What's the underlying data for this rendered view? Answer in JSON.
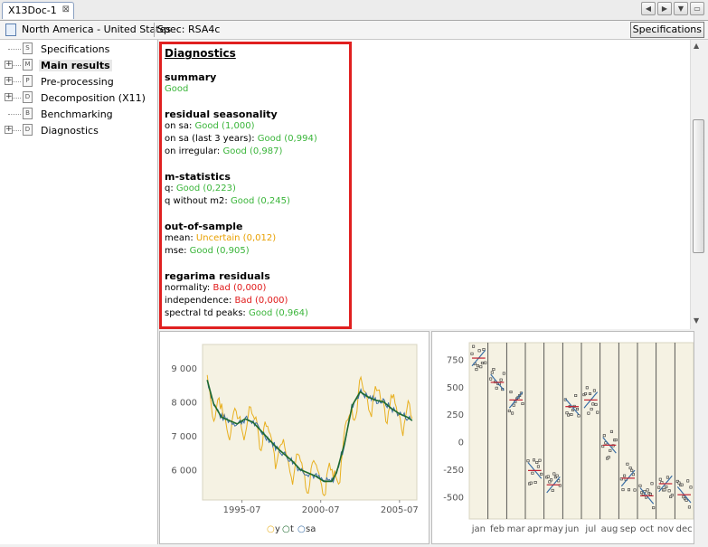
{
  "tab": {
    "title": "X13Doc-1",
    "close": "⊠"
  },
  "nav": {
    "prev": "◀",
    "next": "▶",
    "menu": "▼",
    "restore": "▭"
  },
  "infobar": {
    "region": "North America - United States",
    "spec": "Spec: RSA4c",
    "specifications_button": "Specifications"
  },
  "tree": [
    {
      "label": "Specifications",
      "icon": "S",
      "expandable": false
    },
    {
      "label": "Main results",
      "icon": "M",
      "expandable": true,
      "selected": true
    },
    {
      "label": "Pre-processing",
      "icon": "P",
      "expandable": true
    },
    {
      "label": "Decomposition (X11)",
      "icon": "D",
      "expandable": true
    },
    {
      "label": "Benchmarking",
      "icon": "B",
      "expandable": false
    },
    {
      "label": "Diagnostics",
      "icon": "D",
      "expandable": true
    }
  ],
  "diagnostics": {
    "title": "Diagnostics",
    "summary": {
      "heading": "summary",
      "value": "Good"
    },
    "residual_seasonality": {
      "heading": "residual seasonality",
      "rows": [
        {
          "label": "on sa: ",
          "value": "Good (1,000)",
          "status": "good"
        },
        {
          "label": "on sa (last 3 years): ",
          "value": "Good (0,994)",
          "status": "good"
        },
        {
          "label": "on irregular: ",
          "value": "Good (0,987)",
          "status": "good"
        }
      ]
    },
    "m_statistics": {
      "heading": "m-statistics",
      "rows": [
        {
          "label": "q: ",
          "value": "Good (0,223)",
          "status": "good"
        },
        {
          "label": "q without m2: ",
          "value": "Good (0,245)",
          "status": "good"
        }
      ]
    },
    "out_of_sample": {
      "heading": "out-of-sample",
      "rows": [
        {
          "label": "mean: ",
          "value": "Uncertain (0,012)",
          "status": "unc"
        },
        {
          "label": "mse: ",
          "value": "Good (0,905)",
          "status": "good"
        }
      ]
    },
    "regarima_residuals": {
      "heading": "regarima residuals",
      "rows": [
        {
          "label": "normality: ",
          "value": "Bad (0,000)",
          "status": "bad"
        },
        {
          "label": "independence: ",
          "value": "Bad (0,000)",
          "status": "bad"
        },
        {
          "label": "spectral td peaks: ",
          "value": "Good (0,964)",
          "status": "good"
        }
      ]
    }
  },
  "colors": {
    "y": "#e8b020",
    "t": "#1e6a2e",
    "sa": "#3a6ea5",
    "good": "#3ab53a",
    "bad": "#e01818",
    "uncertain": "#e8a000",
    "plot_bg": "#f5f2e3",
    "highlight": "#e02020"
  },
  "chart_data": [
    {
      "type": "line",
      "x_ticks": [
        "1995-07",
        "2000-07",
        "2005-07"
      ],
      "y_ticks": [
        "6 000",
        "7 000",
        "8 000",
        "9 000"
      ],
      "ylim": [
        5100,
        9700
      ],
      "xlim": [
        1993.0,
        2006.6
      ],
      "legend": [
        {
          "symbol": "○",
          "name": "y"
        },
        {
          "symbol": "○",
          "name": "t"
        },
        {
          "symbol": "○",
          "name": "sa"
        }
      ],
      "legend_position": "bottom",
      "series": [
        {
          "name": "t",
          "x": [
            1993.3,
            1993.7,
            1994.2,
            1994.7,
            1995.2,
            1995.7,
            1996.2,
            1996.7,
            1997.2,
            1997.7,
            1998.2,
            1998.7,
            1999.2,
            1999.7,
            2000.2,
            2000.7,
            2001.2,
            2001.5,
            2002.0,
            2002.5,
            2003.0,
            2003.5,
            2004.0,
            2004.5,
            2005.0,
            2005.5,
            2006.0,
            2006.3
          ],
          "y": [
            8650,
            7950,
            7550,
            7450,
            7350,
            7500,
            7400,
            7150,
            6900,
            6650,
            6450,
            6250,
            6000,
            5900,
            5800,
            5650,
            5650,
            5900,
            6750,
            7900,
            8300,
            8150,
            8050,
            8000,
            7800,
            7650,
            7550,
            7450
          ]
        }
      ]
    },
    {
      "type": "scatter",
      "categories": [
        "jan",
        "feb",
        "mar",
        "apr",
        "may",
        "jun",
        "jul",
        "aug",
        "sep",
        "oct",
        "nov",
        "dec"
      ],
      "y_ticks": [
        "-500",
        "-250",
        "0",
        "250",
        "500",
        "750"
      ],
      "ylim": [
        -700,
        900
      ],
      "series": [
        {
          "name": "mean",
          "values": [
            760,
            540,
            380,
            -260,
            -390,
            320,
            380,
            -30,
            -330,
            -490,
            -380,
            -480
          ]
        }
      ]
    }
  ]
}
